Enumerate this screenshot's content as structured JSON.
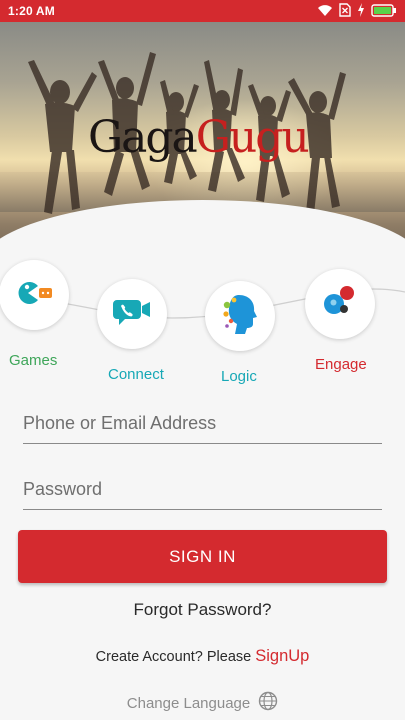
{
  "status_bar": {
    "time": "1:20 AM"
  },
  "brand": {
    "part1": "Gaga",
    "part2": "Gugu"
  },
  "features": [
    {
      "label": "Games",
      "color": "#3fa65a",
      "icon": "pacman-icon"
    },
    {
      "label": "Connect",
      "color": "#17a8b6",
      "icon": "video-chat-icon"
    },
    {
      "label": "Logic",
      "color": "#17a8b6",
      "icon": "brain-head-icon"
    },
    {
      "label": "Engage",
      "color": "#d42a2f",
      "icon": "dots-icon"
    }
  ],
  "form": {
    "identifier_placeholder": "Phone or Email Address",
    "password_placeholder": "Password",
    "signin_label": "SIGN IN",
    "forgot_label": "Forgot Password?",
    "create_account_text": "Create Account? Please",
    "signup_label": "SignUp",
    "change_language_label": "Change Language"
  },
  "colors": {
    "primary_red": "#d42a2f",
    "teal": "#17a8b6",
    "green": "#3fa65a"
  }
}
